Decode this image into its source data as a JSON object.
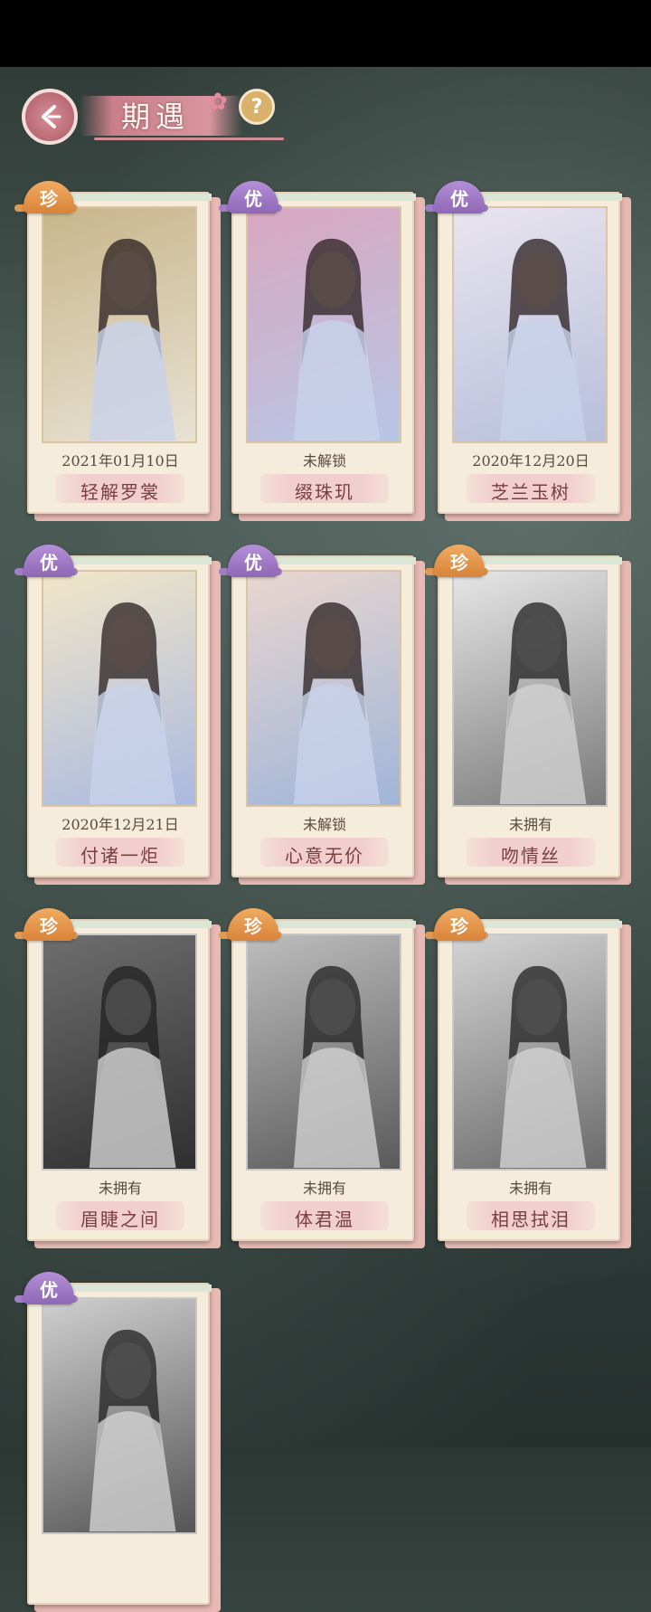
{
  "header": {
    "title": "期遇",
    "help_label": "?"
  },
  "cards": [
    {
      "rarity": "珍",
      "status": "2021年01月10日",
      "name": "轻解罗裳",
      "grayscale": false,
      "palette": [
        "#c8b58a",
        "#e8e2d4"
      ]
    },
    {
      "rarity": "优",
      "status": "未解锁",
      "name": "缀珠玑",
      "grayscale": false,
      "palette": [
        "#d9a7bf",
        "#b8c6e6"
      ]
    },
    {
      "rarity": "优",
      "status": "2020年12月20日",
      "name": "芝兰玉树",
      "grayscale": false,
      "palette": [
        "#e9e4ee",
        "#b7bfdc"
      ]
    },
    {
      "rarity": "优",
      "status": "2020年12月21日",
      "name": "付诸一炬",
      "grayscale": false,
      "palette": [
        "#f2e6c8",
        "#a9b9e0"
      ]
    },
    {
      "rarity": "优",
      "status": "未解锁",
      "name": "心意无价",
      "grayscale": false,
      "palette": [
        "#e9d6cf",
        "#9fb5d9"
      ]
    },
    {
      "rarity": "珍",
      "status": "未拥有",
      "name": "吻情丝",
      "grayscale": true,
      "palette": [
        "#e6e6e6",
        "#7a7a7a"
      ]
    },
    {
      "rarity": "珍",
      "status": "未拥有",
      "name": "眉睫之间",
      "grayscale": true,
      "palette": [
        "#6e6e6e",
        "#2f2f2f"
      ]
    },
    {
      "rarity": "珍",
      "status": "未拥有",
      "name": "体君温",
      "grayscale": true,
      "palette": [
        "#bdbdbd",
        "#5a5a5a"
      ]
    },
    {
      "rarity": "珍",
      "status": "未拥有",
      "name": "相思拭泪",
      "grayscale": true,
      "palette": [
        "#d4d4d4",
        "#6a6a6a"
      ]
    },
    {
      "rarity": "优",
      "status": "",
      "name": "",
      "grayscale": true,
      "palette": [
        "#cfcfcf",
        "#555555"
      ]
    }
  ]
}
